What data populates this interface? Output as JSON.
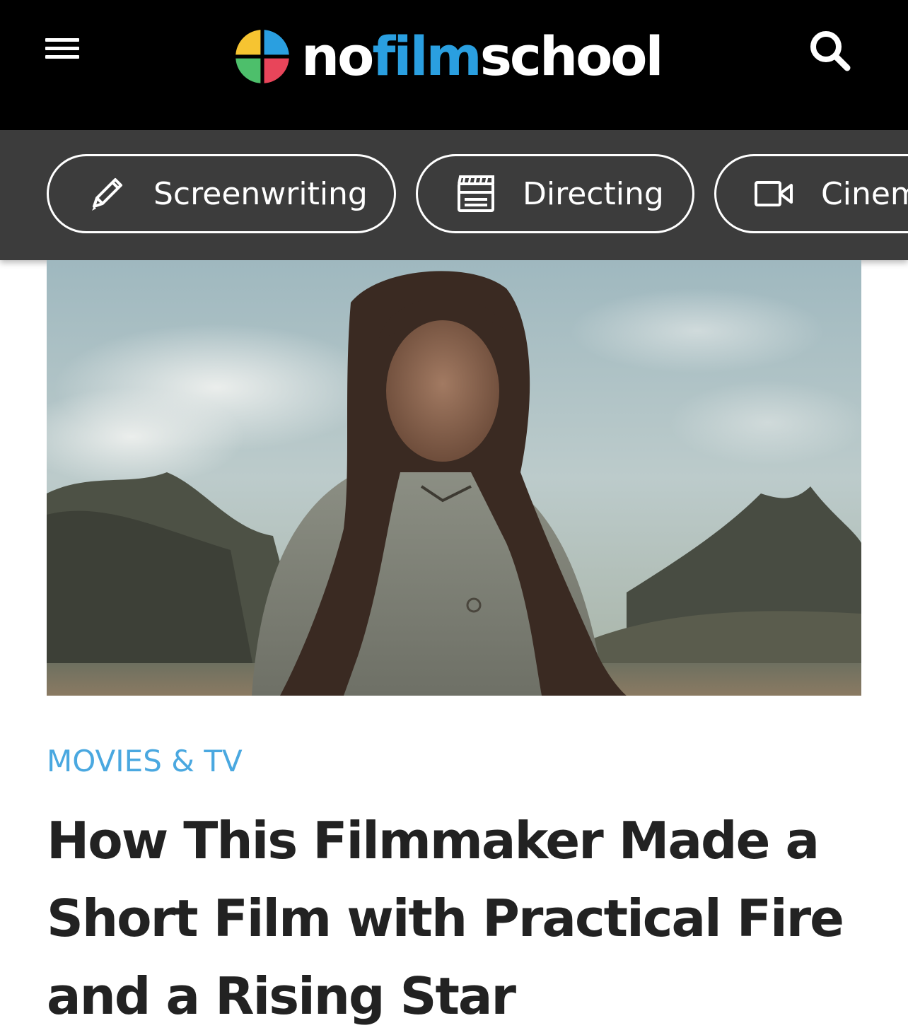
{
  "header": {
    "brand": {
      "prefix": "no",
      "highlight": "film",
      "suffix": "school"
    },
    "menu_icon": "hamburger-menu-icon",
    "search_icon": "search-icon",
    "colors": {
      "background": "#000000",
      "brand_accent": "#2a9fe0"
    }
  },
  "categories": {
    "items": [
      {
        "label": "Screenwriting",
        "icon": "pencil-icon"
      },
      {
        "label": "Directing",
        "icon": "clapperboard-icon"
      },
      {
        "label": "Cinem",
        "icon": "video-camera-icon"
      }
    ]
  },
  "article": {
    "hero_image": "woman-with-long-curly-hair-in-landscape-with-mountains",
    "category": "MOVIES & TV",
    "headline": "How This Filmmaker Made a Short Film with Practical Fire and a Rising Star",
    "colors": {
      "category": "#4aa8e0",
      "headline": "#222222"
    }
  }
}
